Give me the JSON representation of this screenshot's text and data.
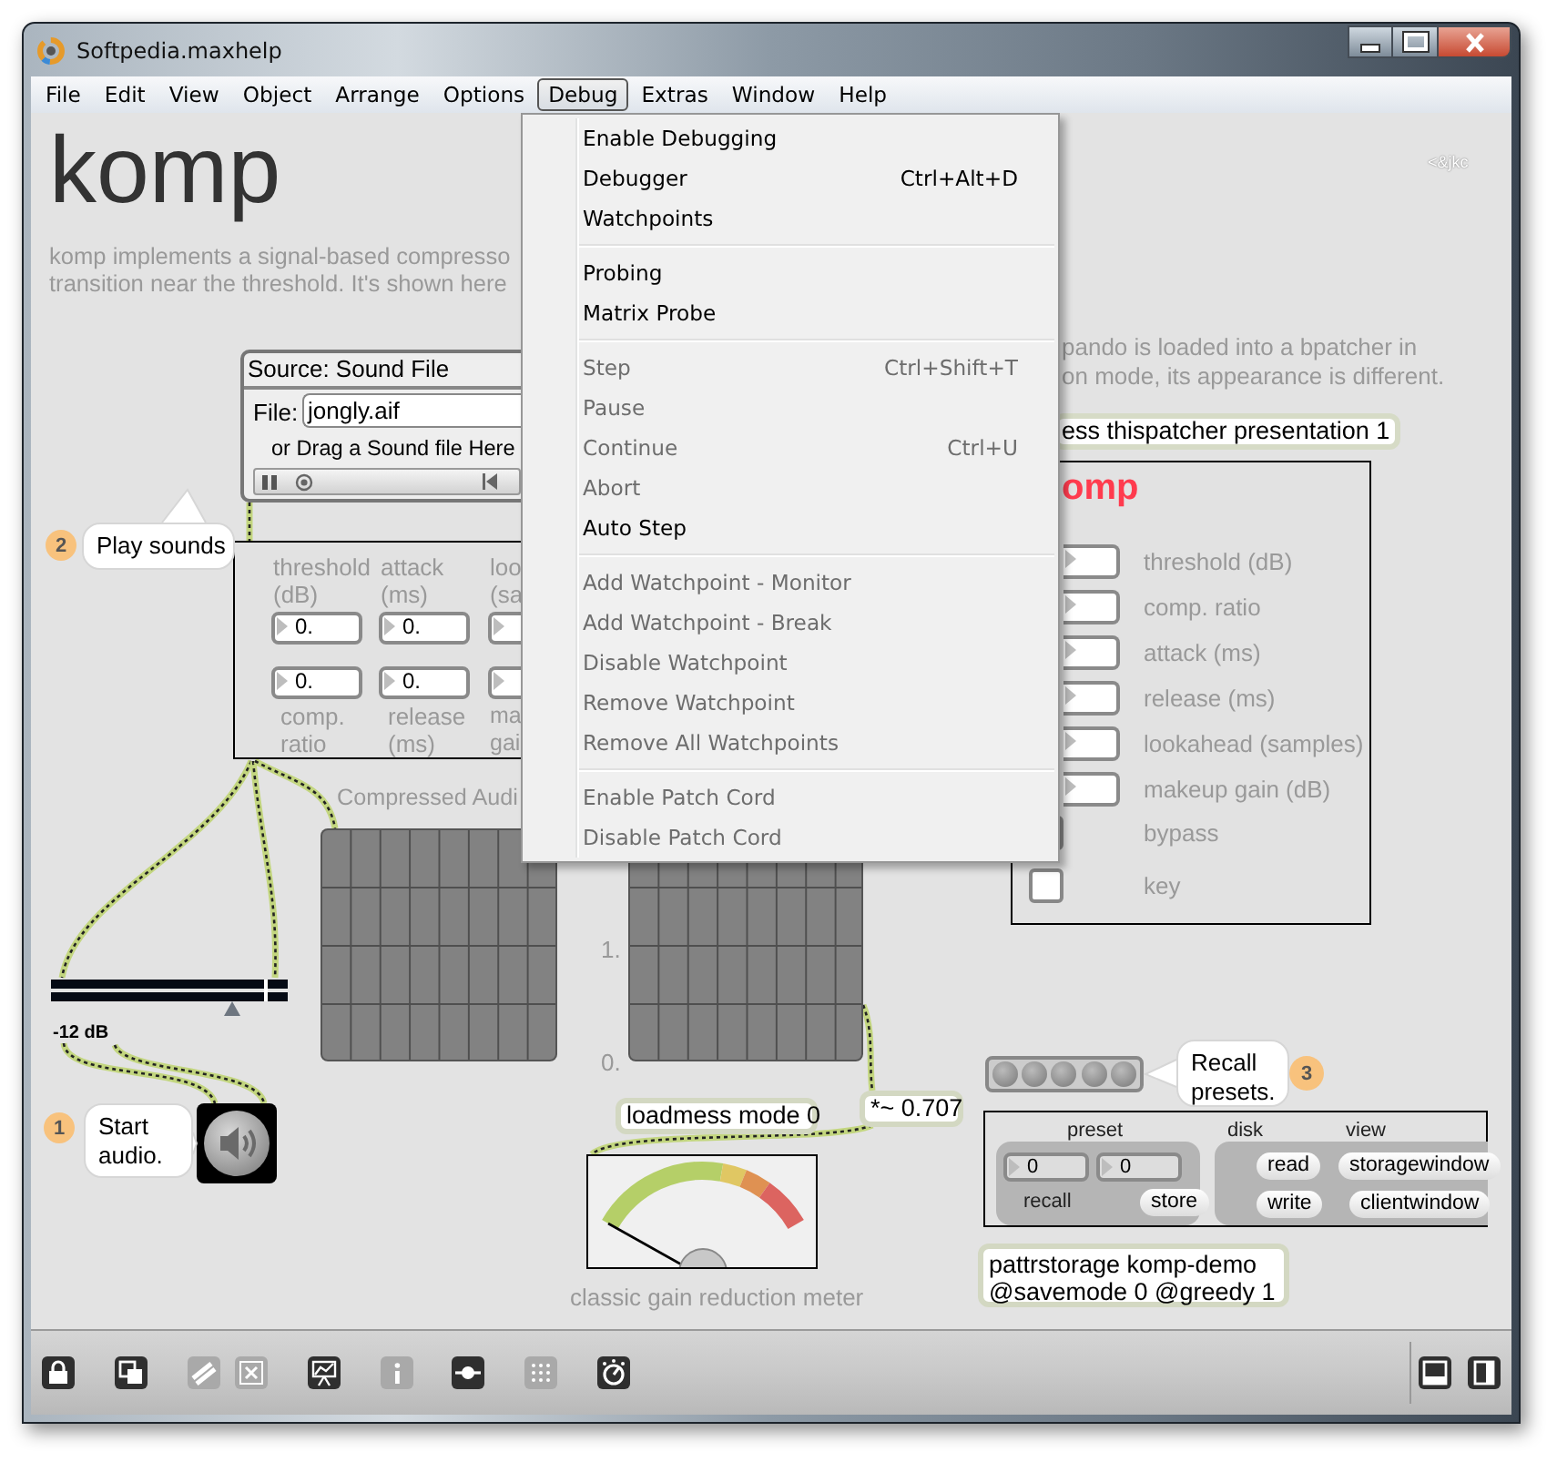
{
  "window": {
    "title": "Softpedia.maxhelp"
  },
  "menu_bar": [
    {
      "label": "File",
      "selected": false
    },
    {
      "label": "Edit",
      "selected": false
    },
    {
      "label": "View",
      "selected": false
    },
    {
      "label": "Object",
      "selected": false
    },
    {
      "label": "Arrange",
      "selected": false
    },
    {
      "label": "Options",
      "selected": false
    },
    {
      "label": "Debug",
      "selected": true
    },
    {
      "label": "Extras",
      "selected": false
    },
    {
      "label": "Window",
      "selected": false
    },
    {
      "label": "Help",
      "selected": false
    }
  ],
  "debug_menu": {
    "groups": [
      [
        {
          "label": "Enable Debugging",
          "disabled": false
        },
        {
          "label": "Debugger",
          "shortcut": "Ctrl+Alt+D",
          "disabled": false
        },
        {
          "label": "Watchpoints",
          "disabled": false
        }
      ],
      [
        {
          "label": "Probing",
          "disabled": false
        },
        {
          "label": "Matrix Probe",
          "disabled": false
        }
      ],
      [
        {
          "label": "Step",
          "shortcut": "Ctrl+Shift+T",
          "disabled": true
        },
        {
          "label": "Pause",
          "disabled": true
        },
        {
          "label": "Continue",
          "shortcut": "Ctrl+U",
          "disabled": true
        },
        {
          "label": "Abort",
          "disabled": true
        },
        {
          "label": "Auto Step",
          "disabled": false
        }
      ],
      [
        {
          "label": "Add Watchpoint - Monitor",
          "disabled": true
        },
        {
          "label": "Add Watchpoint - Break",
          "disabled": true
        },
        {
          "label": "Disable Watchpoint",
          "disabled": true
        },
        {
          "label": "Remove Watchpoint",
          "disabled": true
        },
        {
          "label": "Remove All Watchpoints",
          "disabled": true
        }
      ],
      [
        {
          "label": "Enable Patch Cord",
          "disabled": true
        },
        {
          "label": "Disable Patch Cord",
          "disabled": true
        }
      ]
    ]
  },
  "patcher": {
    "title": "komp",
    "credit": "<&jkc",
    "description": [
      "komp implements a signal-based compresso",
      "transition near the threshold. It's shown here"
    ],
    "presentation_note": [
      "pando is loaded into a bpatcher in",
      "on mode, its appearance is different."
    ],
    "presentation_message": "ess thispatcher presentation 1",
    "bpatcher": {
      "title": "omp",
      "controls": [
        {
          "kind": "number",
          "label": "threshold (dB)"
        },
        {
          "kind": "number",
          "label": "comp. ratio"
        },
        {
          "kind": "number",
          "label": "attack (ms)"
        },
        {
          "kind": "number",
          "label": "release (ms)"
        },
        {
          "kind": "number",
          "label": "lookahead (samples)"
        },
        {
          "kind": "number",
          "label": "makeup gain (dB)"
        },
        {
          "kind": "toggle",
          "label": "bypass"
        },
        {
          "kind": "toggle",
          "label": "key",
          "checked": false
        }
      ]
    },
    "source": {
      "header": "Source: Sound File",
      "file_label": "File:",
      "file": "jongly.aif",
      "drop_hint": "or Drag a Sound file Here"
    },
    "params": [
      {
        "top_label": "threshold (dB)",
        "top_value": "0.",
        "bottom_value": "0.",
        "bottom_label": "comp. ratio"
      },
      {
        "top_label": "attack (ms)",
        "top_value": "0.",
        "bottom_value": "0.",
        "bottom_label": "release (ms)"
      },
      {
        "top_label": "loo (sa",
        "bottom_label": "ma gai"
      }
    ],
    "steps": [
      {
        "number": "2",
        "text": "Play sounds"
      },
      {
        "number": "1",
        "text": "Start audio."
      },
      {
        "number": "3",
        "text": "Recall presets."
      }
    ],
    "scope_label": "Compressed Audi",
    "scope_ticks": [
      "1.",
      "0."
    ],
    "gain_slider": {
      "level": 0.76,
      "reading": "-12 dB"
    },
    "loadmess": "loadmess mode 0",
    "multiplier": "*~ 0.707",
    "meter_caption": "classic gain reduction meter",
    "pattr": {
      "headers": [
        "preset",
        "disk",
        "view"
      ],
      "values": [
        "0",
        "0"
      ],
      "recall_label": "recall",
      "buttons": [
        "store",
        "read",
        "write",
        "storagewindow",
        "clientwindow"
      ]
    },
    "pattrstorage": "pattrstorage komp-demo @savemode 0 @greedy 1"
  },
  "toolbar": [
    {
      "kind": "lock",
      "disabled": false
    },
    {
      "kind": "layers",
      "disabled": false
    },
    {
      "kind": "cords",
      "disabled": true
    },
    {
      "kind": "delete",
      "disabled": true
    },
    {
      "kind": "presentation",
      "disabled": false
    },
    {
      "kind": "info",
      "disabled": true
    },
    {
      "kind": "slider",
      "disabled": false
    },
    {
      "kind": "grid",
      "disabled": true
    },
    {
      "kind": "knob",
      "disabled": false
    },
    {
      "kind": "bottom_panel",
      "disabled": false
    },
    {
      "kind": "side_panel",
      "disabled": false
    }
  ]
}
